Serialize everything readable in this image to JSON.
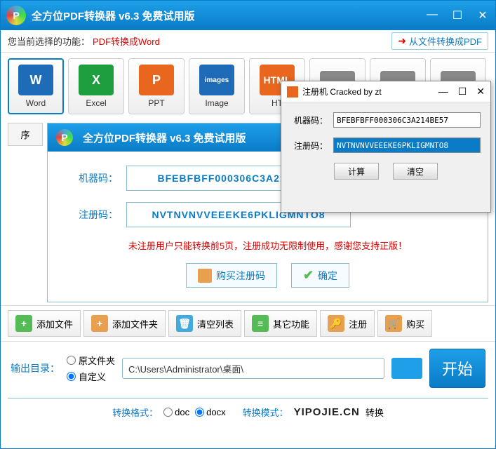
{
  "window": {
    "title": "全方位PDF转换器 v6.3 免费试用版"
  },
  "funcbar": {
    "label": "您当前选择的功能：",
    "current": "PDF转换成Word",
    "right_link": "从文件转换成PDF"
  },
  "formats": [
    {
      "label": "Word",
      "icon": "W"
    },
    {
      "label": "Excel",
      "icon": "X"
    },
    {
      "label": "PPT",
      "icon": "P"
    },
    {
      "label": "Image",
      "icon": "images"
    },
    {
      "label": "HT",
      "icon": "HTML"
    },
    {
      "label": "",
      "icon": ""
    },
    {
      "label": "",
      "icon": "<xml>"
    },
    {
      "label": "",
      "icon": ""
    }
  ],
  "side": {
    "header": "序"
  },
  "reg": {
    "title": "全方位PDF转换器 v6.3 免费试用版",
    "machine_label": "机器码：",
    "machine_code": "BFEBFBFF000306C3A214BE57",
    "reg_label": "注册码：",
    "reg_code": "NVTNVNVVEEEKE6PKLIGMNTO8",
    "note": "未注册用户只能转换前5页，注册成功无限制使用，感谢您支持正版！",
    "buy_btn": "购买注册码",
    "ok_btn": "确定"
  },
  "toolbar": {
    "add_file": "添加文件",
    "add_folder": "添加文件夹",
    "clear_list": "清空列表",
    "other": "其它功能",
    "register": "注册",
    "buy": "购买"
  },
  "output": {
    "label": "输出目录：",
    "radio_original": "原文件夹",
    "radio_custom": "自定义",
    "path": "C:\\Users\\Administrator\\桌面\\"
  },
  "start_btn": "开始",
  "bottom": {
    "format_label": "转换格式：",
    "format_doc": "doc",
    "format_docx": "docx",
    "mode_label": "转换模式：",
    "watermark": "YIPOJIE.CN"
  },
  "crack": {
    "title": "注册机 Cracked by zt",
    "machine_label": "机器码：",
    "machine_code": "BFEBFBFF000306C3A214BE57",
    "reg_label": "注册码：",
    "reg_code": "NVTNVNVVEEEKE6PKLIGMNTO8",
    "calc_btn": "计算",
    "clear_btn": "清空"
  }
}
